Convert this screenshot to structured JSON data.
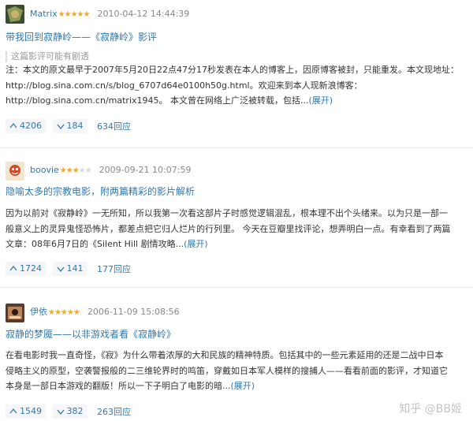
{
  "reviews": [
    {
      "author": "Matrix",
      "stars_filled": "★★★★★",
      "stars_empty": "",
      "rating": 5,
      "time": "2010-04-12 14:44:39",
      "title": "带我回到寂静岭——《寂静岭》影评",
      "spoiler": "这篇影评可能有剧透",
      "lines": [
        "注：本文的原文最早于2007年5月20日22点47分17秒发表在本人的博客上，因原博客被封，只能重发。本文现地址：",
        "http://blog.sina.com.cn/s/blog_6707d64e0100h50g.html。欢迎来到本人现新浪博客：",
        "http://blog.sina.com.cn/matrix1945。 本文曾在网络上广泛被转载，包括..."
      ],
      "expand": "(展开)",
      "up": "4206",
      "down": "184",
      "replies": "634回应"
    },
    {
      "author": "boovie",
      "stars_filled": "★★★",
      "stars_empty": "★★",
      "rating": 3,
      "time": "2009-09-21 10:07:59",
      "title": "隐喻太多的宗教电影，附两篇精彩的影片解析",
      "lines": [
        "因为以前对《寂静岭》一无所知，所以我第一次看这部片子时感觉逻辑混乱，根本理不出个头绪来。以为只是一部一",
        "般意义上的灵异鬼怪恐怖片，都差点把它归人烂片的行列里。 今天在豆瓣里找评论，想弄明白一点。有幸看到了两篇",
        "文章：08年6月7日的《Silent Hill 剧情攻略..."
      ],
      "expand": "(展开)",
      "up": "1724",
      "down": "141",
      "replies": "177回应"
    },
    {
      "author": "伊依",
      "stars_filled": "★★★★★",
      "stars_empty": "",
      "rating": 5,
      "time": "2006-11-09 15:08:56",
      "title": "寂静的梦魇——以非游戏者看《寂静岭》",
      "lines": [
        "在看电影时我一直奇怪，《寂》为什么带着浓厚的大和民族的精神特质。包括其中的一些元素延用的还是二战中日本",
        "侵略主义的原型，空袭警报般的二三维轮界时的鸣笛，穿戴如日本军人模样的搜捕人——看看前面的影评，才知道它",
        "本身是一部日本游戏的翻版！所以一下子明白了电影的暗..."
      ],
      "expand": "(展开)",
      "up": "1549",
      "down": "382",
      "replies": "263回应"
    }
  ],
  "watermark": "知乎 @BB姬",
  "colors": {
    "link": "#3377aa",
    "star": "#f5a623",
    "text": "#333333",
    "muted": "#888888"
  },
  "icons": {
    "up": "thumb-up-arrow-icon",
    "down": "thumb-down-arrow-icon"
  }
}
